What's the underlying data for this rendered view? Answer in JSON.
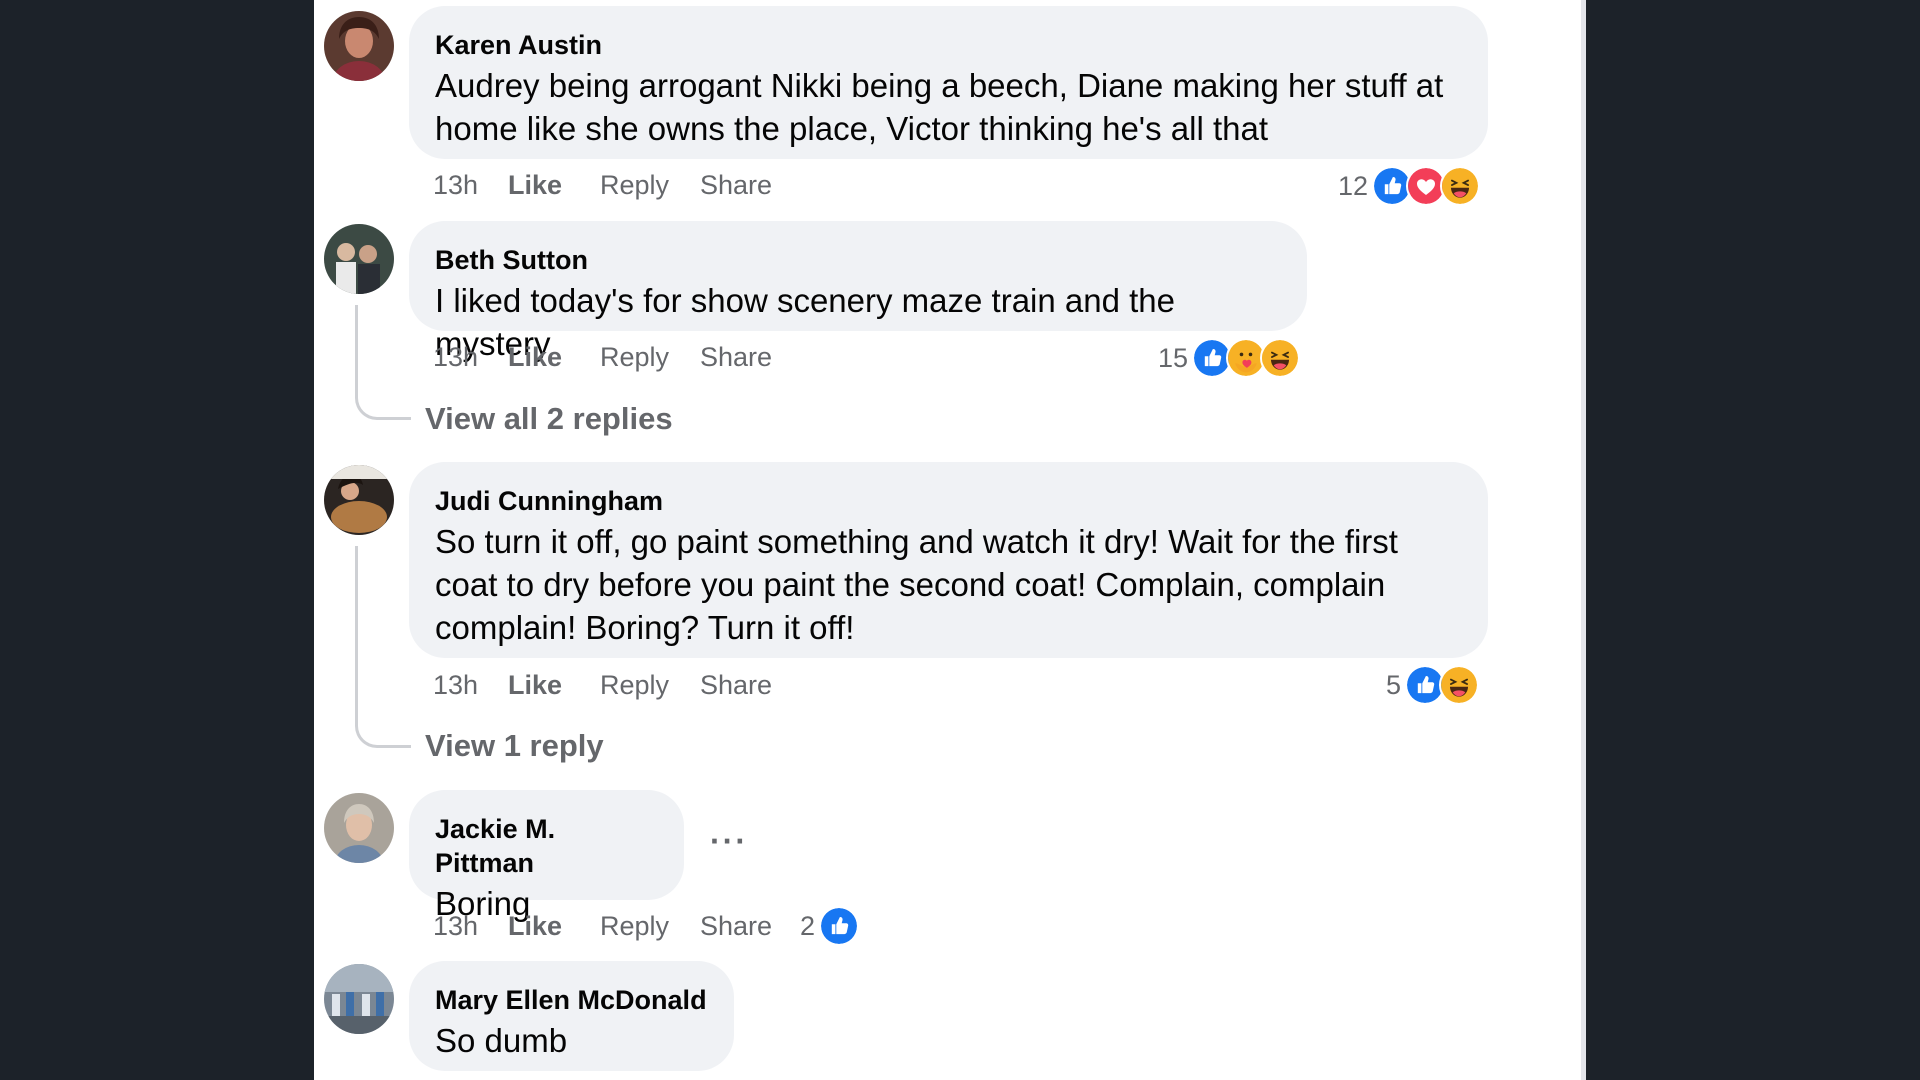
{
  "comments": [
    {
      "author": "Karen Austin",
      "text": "Audrey being arrogant Nikki being a beech, Diane making her stuff at home like she owns the place, Victor thinking he's all that",
      "time": "13h",
      "like": "Like",
      "reply": "Reply",
      "share": "Share",
      "reaction_count": "12",
      "reactions": [
        "like-icon",
        "love-icon",
        "haha-icon"
      ]
    },
    {
      "author": "Beth Sutton",
      "text": "I liked today's for show scenery maze train and the mystery",
      "time": "13h",
      "like": "Like",
      "reply": "Reply",
      "share": "Share",
      "reaction_count": "15",
      "reactions": [
        "like-icon",
        "care-icon",
        "haha-icon"
      ],
      "view_replies": "View all 2 replies"
    },
    {
      "author": "Judi Cunningham",
      "text": "So turn it off, go paint something and watch it dry! Wait for the first coat to dry before you paint the second coat! Complain, complain complain! Boring? Turn it off!",
      "time": "13h",
      "like": "Like",
      "reply": "Reply",
      "share": "Share",
      "reaction_count": "5",
      "reactions": [
        "like-icon",
        "haha-icon"
      ],
      "view_replies": "View 1 reply"
    },
    {
      "author": "Jackie M. Pittman",
      "text": "Boring",
      "time": "13h",
      "like": "Like",
      "reply": "Reply",
      "share": "Share",
      "reaction_count": "2",
      "reactions": [
        "like-icon"
      ],
      "more": "···"
    },
    {
      "author": "Mary Ellen McDonald",
      "text": "So dumb"
    }
  ],
  "colors": {
    "background": "#1c2229",
    "bubble": "#f0f2f5",
    "muted_text": "#65676b",
    "like_blue": "#1877f2",
    "love_red": "#f33e58",
    "haha_yellow": "#f7b125"
  }
}
